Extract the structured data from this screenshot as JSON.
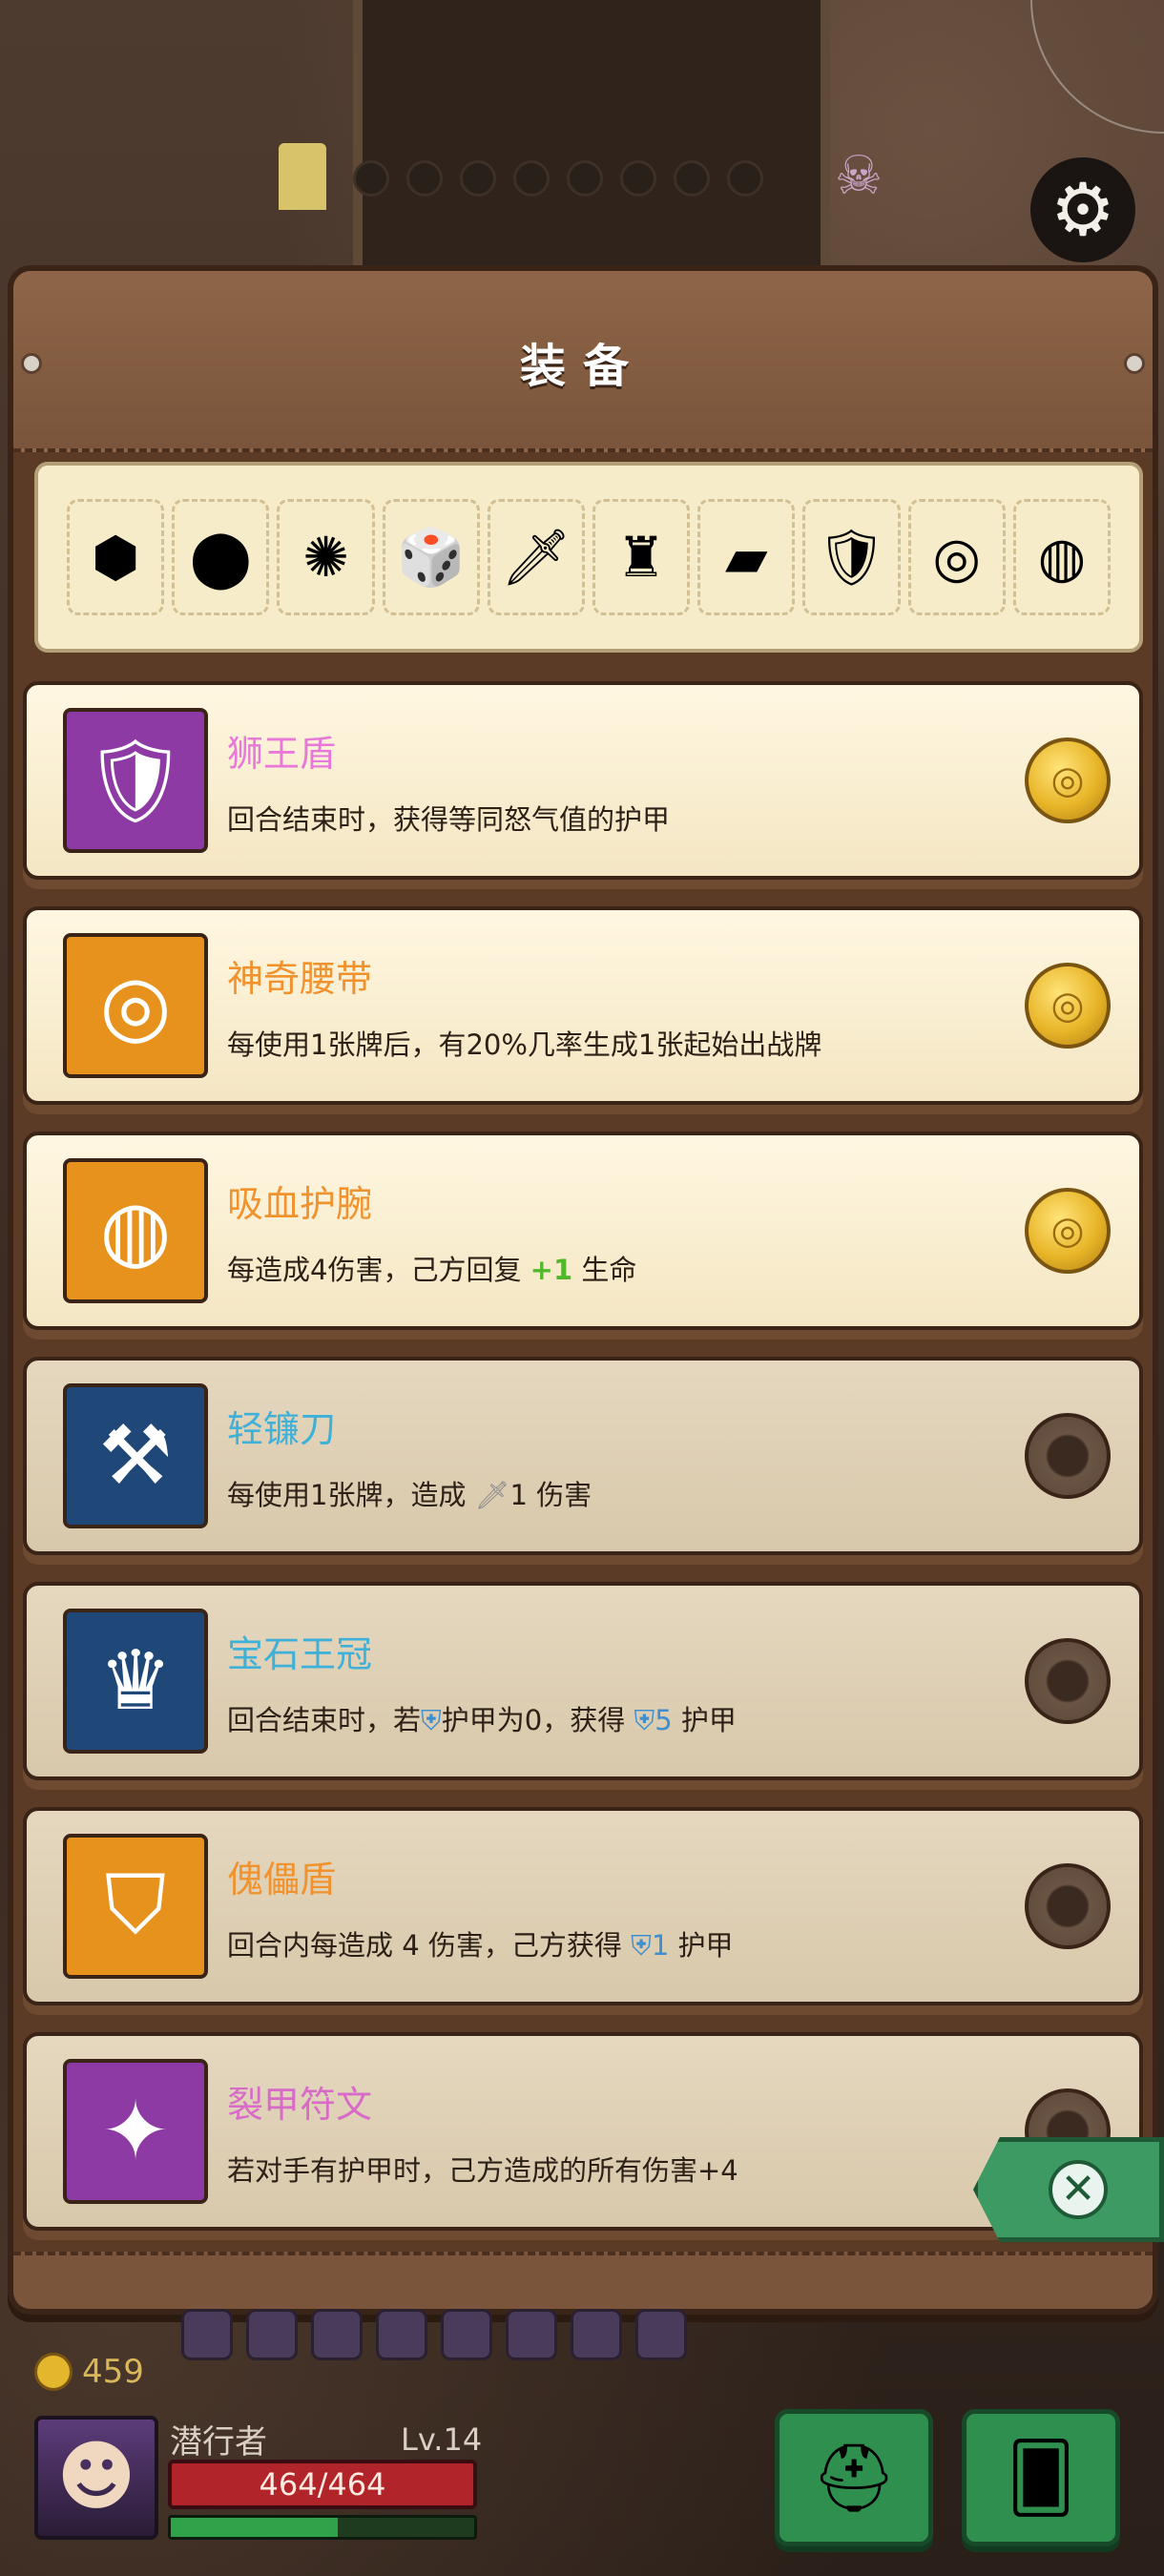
{
  "panel": {
    "title": "装备"
  },
  "strip_items": [
    {
      "icon": "metal-cube-icon",
      "glyph": "⬢"
    },
    {
      "icon": "lava-stone-icon",
      "glyph": "⬤"
    },
    {
      "icon": "pink-flame-icon",
      "glyph": "✺"
    },
    {
      "icon": "dice-hat-icon",
      "glyph": "🎲"
    },
    {
      "icon": "crystal-dagger-icon",
      "glyph": "🗡"
    },
    {
      "icon": "red-cloak-icon",
      "glyph": "♜"
    },
    {
      "icon": "green-slab-icon",
      "glyph": "▰"
    },
    {
      "icon": "lion-shield-icon",
      "glyph": "🛡"
    },
    {
      "icon": "magic-belt-icon",
      "glyph": "◎"
    },
    {
      "icon": "vampire-bracer-icon",
      "glyph": "◍"
    }
  ],
  "equipment": [
    {
      "name": "狮王盾",
      "name_color": "#e879d8",
      "icon": "lion-shield-icon",
      "glyph": "🛡",
      "icon_bg": "#8e3aa5",
      "desc": "回合结束时，获得等同怒气值的护甲",
      "status": "owned"
    },
    {
      "name": "神奇腰带",
      "name_color": "#f0922e",
      "icon": "magic-belt-icon",
      "glyph": "◎",
      "icon_bg": "#e8921e",
      "desc": "每使用1张牌后，有20%几率生成1张起始出战牌",
      "status": "owned"
    },
    {
      "name": "吸血护腕",
      "name_color": "#f0922e",
      "icon": "vampire-bracer-icon",
      "glyph": "◍",
      "icon_bg": "#e8921e",
      "desc_pre": "每造成4伤害，己方回复 ",
      "desc_value": "+1",
      "desc_post": " 生命",
      "status": "owned"
    },
    {
      "name": "轻镰刀",
      "name_color": "#3fb0d8",
      "icon": "light-scythe-icon",
      "glyph": "⚒",
      "icon_bg": "#1f4878",
      "desc_pre": "每使用1张牌，造成 ",
      "desc_value": "1",
      "desc_post": " 伤害",
      "status": "locked"
    },
    {
      "name": "宝石王冠",
      "name_color": "#3fb0d8",
      "icon": "gem-crown-icon",
      "glyph": "♛",
      "icon_bg": "#1f4878",
      "desc_pre": "回合结束时，若",
      "desc_mid": "护甲为0，获得 ",
      "desc_value": "5",
      "desc_post": " 护甲",
      "status": "locked"
    },
    {
      "name": "傀儡盾",
      "name_color": "#f0922e",
      "icon": "puppet-shield-icon",
      "glyph": "⛉",
      "icon_bg": "#e8921e",
      "desc_pre": "回合内每造成 4 伤害，己方获得 ",
      "desc_value": "1",
      "desc_post": " 护甲",
      "status": "locked"
    },
    {
      "name": "裂甲符文",
      "name_color": "#d86ac8",
      "icon": "armor-break-rune-icon",
      "glyph": "✦",
      "icon_bg": "#8e3aa5",
      "desc": "若对手有护甲时，己方造成的所有伤害+4",
      "status": "locked"
    }
  ],
  "player": {
    "gold": "459",
    "name": "潜行者",
    "level": "Lv.14",
    "hp": "464/464",
    "xp_fraction": 0.55
  }
}
